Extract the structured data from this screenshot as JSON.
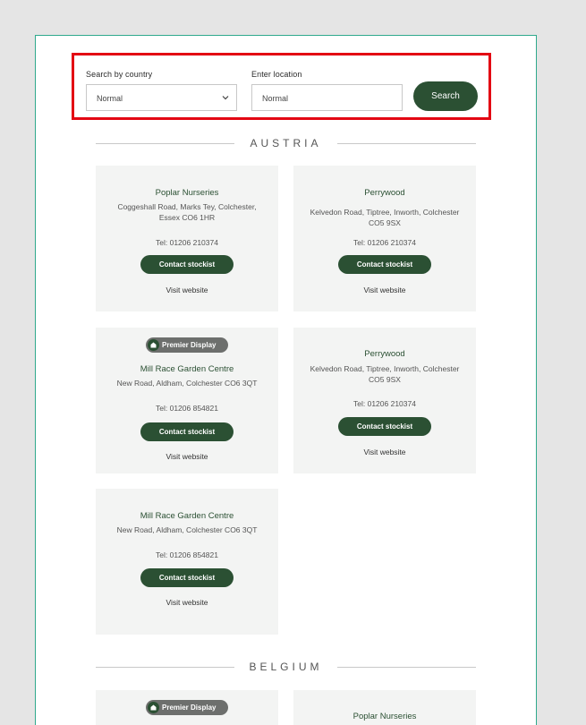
{
  "search": {
    "country_label": "Search by country",
    "country_value": "Normal",
    "location_label": "Enter location",
    "location_value": "Normal",
    "button_label": "Search"
  },
  "sections": [
    {
      "title": "AUSTRIA",
      "cards": [
        {
          "name": "Poplar Nurseries",
          "address": "Coggeshall Road, Marks Tey, Colchester, Essex CO6 1HR",
          "tel": "Tel: 01206 210374",
          "contact": "Contact stockist",
          "visit": "Visit website"
        },
        {
          "name": "Perrywood",
          "address": "Kelvedon Road, Tiptree, Inworth, Colchester CO5 9SX",
          "tel": "Tel: 01206 210374",
          "contact": "Contact stockist",
          "visit": "Visit website"
        },
        {
          "badge": "Premier Display",
          "name": "Mill Race Garden Centre",
          "address": "New Road, Aldham, Colchester CO6 3QT",
          "tel": "Tel: 01206 854821",
          "contact": "Contact stockist",
          "visit": "Visit website"
        },
        {
          "name": "Perrywood",
          "address": "Kelvedon Road, Tiptree, Inworth, Colchester CO5 9SX",
          "tel": "Tel: 01206 210374",
          "contact": "Contact stockist",
          "visit": "Visit website"
        },
        {
          "name": "Mill Race Garden Centre",
          "address": "New Road, Aldham, Colchester CO6 3QT",
          "tel": "Tel: 01206 854821",
          "contact": "Contact stockist",
          "visit": "Visit website"
        }
      ]
    },
    {
      "title": "BELGIUM",
      "cards": [
        {
          "badge": "Premier Display"
        },
        {
          "name": "Poplar Nurseries"
        }
      ]
    }
  ],
  "colors": {
    "accent": "#2b5033",
    "highlight_border": "#e30613",
    "card_bg": "#f3f4f3",
    "badge_bg": "#6d6f6d"
  },
  "icons": {
    "select_chevron": "chevron-down-icon",
    "badge_icon": "plant-badge-icon"
  }
}
